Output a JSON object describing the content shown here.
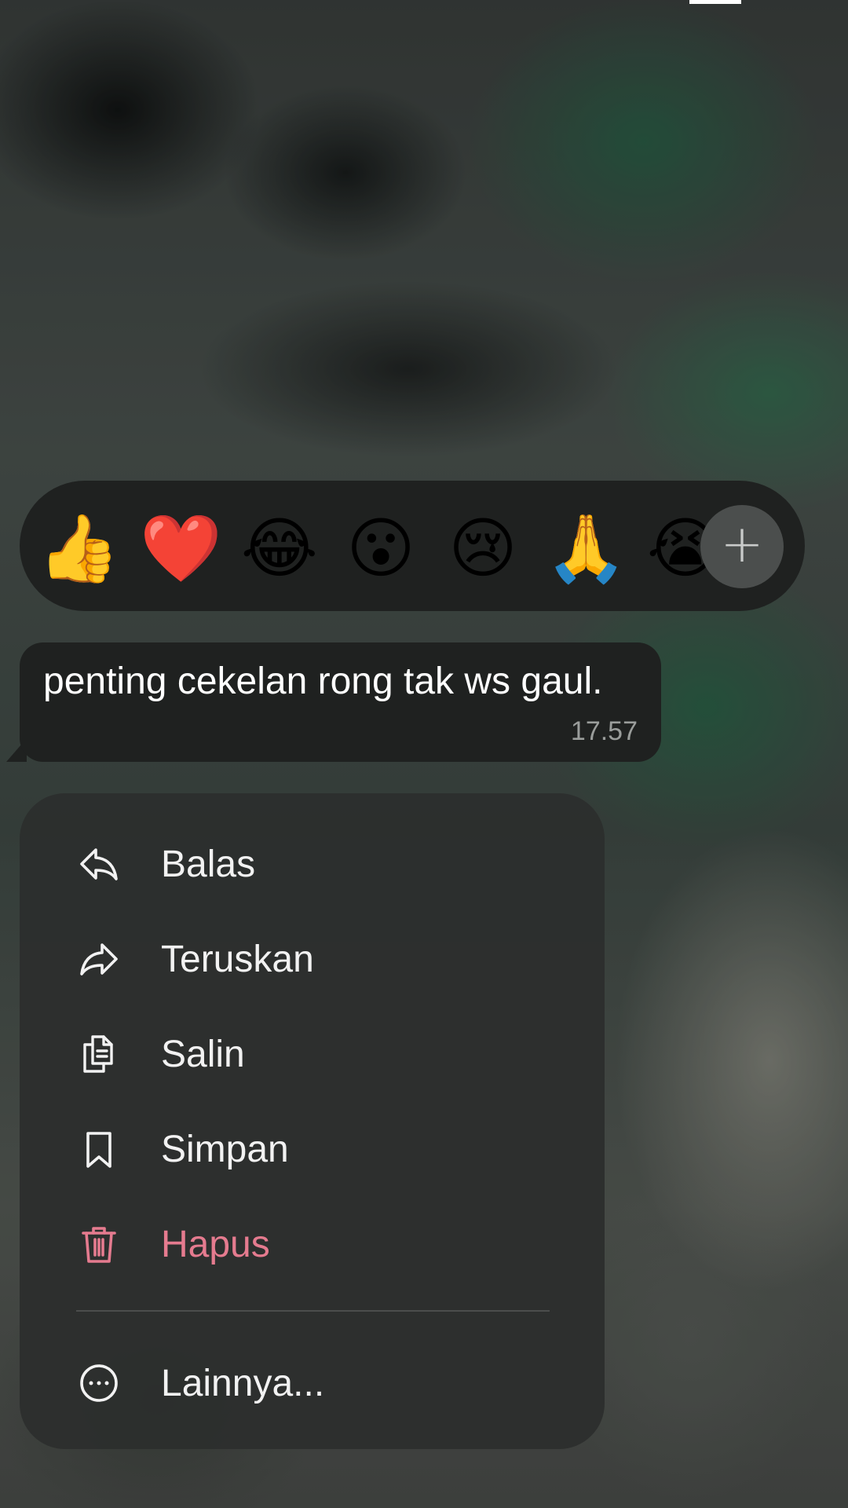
{
  "reactions": {
    "emojis": [
      {
        "name": "thumbs-up",
        "glyph": "👍"
      },
      {
        "name": "red-heart",
        "glyph": "❤️"
      },
      {
        "name": "tears-of-joy",
        "glyph": "😂"
      },
      {
        "name": "surprised",
        "glyph": "😮"
      },
      {
        "name": "crying",
        "glyph": "😢"
      },
      {
        "name": "folded-hands",
        "glyph": "🙏"
      },
      {
        "name": "loudly-crying",
        "glyph": "😭"
      }
    ],
    "more_glyph": "+"
  },
  "message": {
    "text": "penting cekelan rong tak ws gaul.",
    "time": "17.57"
  },
  "menu": {
    "items": [
      {
        "label": "Balas",
        "icon": "reply-icon"
      },
      {
        "label": "Teruskan",
        "icon": "forward-icon"
      },
      {
        "label": "Salin",
        "icon": "copy-icon"
      },
      {
        "label": "Simpan",
        "icon": "bookmark-icon"
      },
      {
        "label": "Hapus",
        "icon": "trash-icon",
        "color": "#e57b8f"
      }
    ],
    "more": {
      "label": "Lainnya...",
      "icon": "more-horizontal-icon"
    }
  }
}
